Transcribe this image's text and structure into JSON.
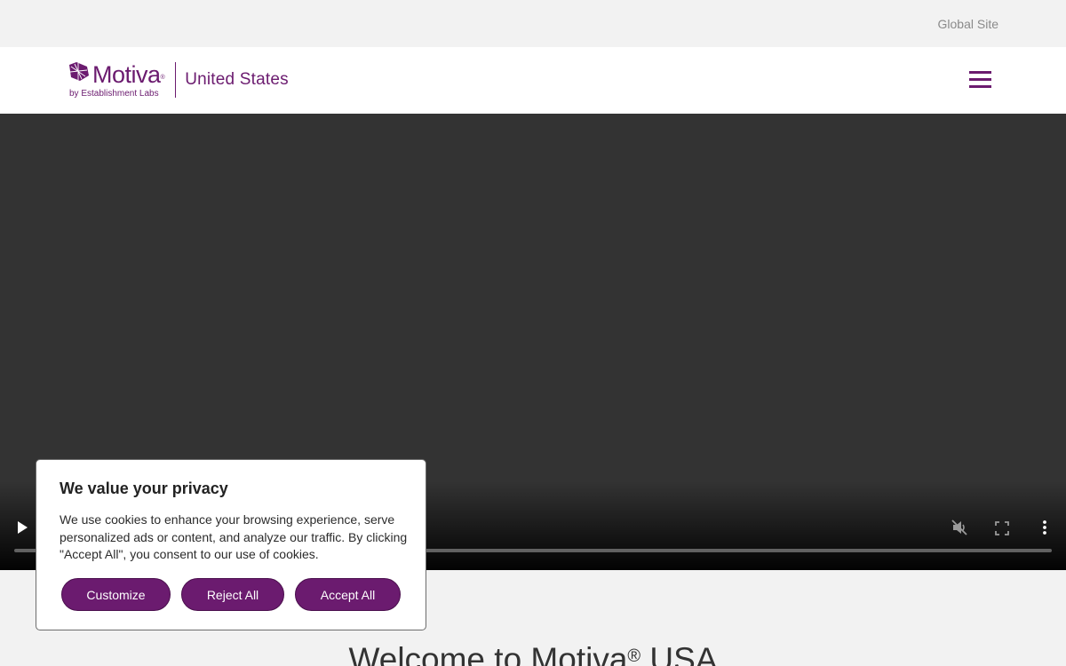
{
  "topbar": {
    "global_site_label": "Global Site"
  },
  "header": {
    "logo_word": "Motiva",
    "logo_reg": "®",
    "logo_sub": "by Establishment Labs",
    "country": "United States",
    "menu_icon": "hamburger-icon"
  },
  "video": {
    "controls": {
      "play_icon": "play-icon",
      "mute_icon": "muted-speaker-icon",
      "fullscreen_icon": "fullscreen-icon",
      "more_icon": "more-vertical-icon"
    }
  },
  "welcome": {
    "text_before": "Welcome to Motiva",
    "reg": "®",
    "text_after": " USA"
  },
  "cookie": {
    "title": "We value your privacy",
    "body": "We use cookies to enhance your browsing experience, serve personalized ads or content, and analyze our traffic. By clicking \"Accept All\", you consent to our use of cookies.",
    "customize_label": "Customize",
    "reject_label": "Reject All",
    "accept_label": "Accept All"
  },
  "colors": {
    "brand": "#6b1b6f",
    "video_bg": "#333333",
    "page_bg": "#f2f2f2"
  }
}
